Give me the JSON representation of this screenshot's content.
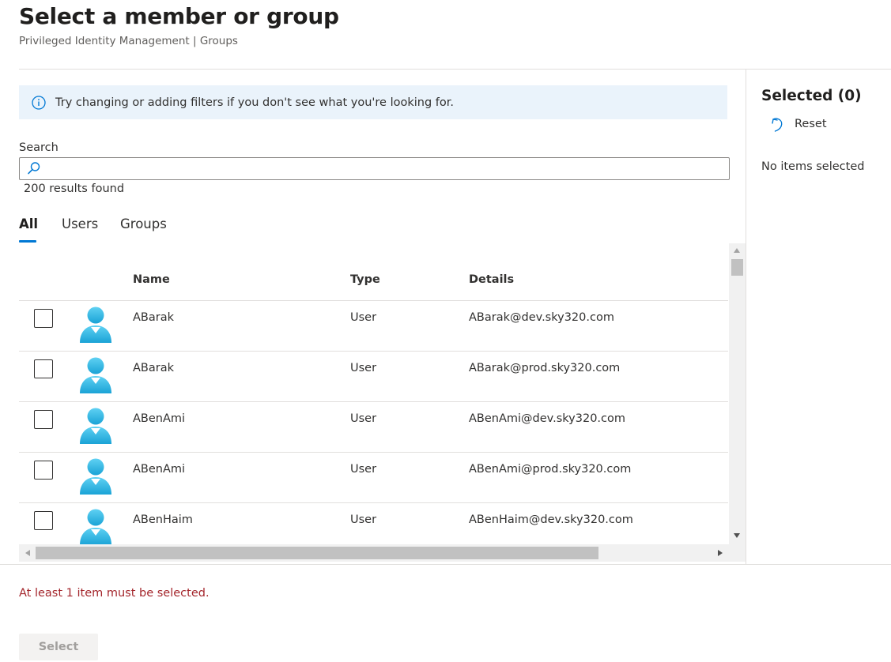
{
  "header": {
    "title": "Select a member or group",
    "subtitle": "Privileged Identity Management | Groups"
  },
  "info_bar": {
    "icon": "info-icon",
    "text": "Try changing or adding filters if you don't see what you're looking for."
  },
  "search": {
    "label": "Search",
    "value": "",
    "placeholder": "",
    "icon": "search-icon",
    "results_text": "200 results found"
  },
  "tabs": [
    {
      "label": "All",
      "active": true
    },
    {
      "label": "Users",
      "active": false
    },
    {
      "label": "Groups",
      "active": false
    }
  ],
  "table": {
    "columns": [
      "Name",
      "Type",
      "Details"
    ],
    "rows": [
      {
        "name": "ABarak",
        "type": "User",
        "details": "ABarak@dev.sky320.com",
        "checked": false
      },
      {
        "name": "ABarak",
        "type": "User",
        "details": "ABarak@prod.sky320.com",
        "checked": false
      },
      {
        "name": "ABenAmi",
        "type": "User",
        "details": "ABenAmi@dev.sky320.com",
        "checked": false
      },
      {
        "name": "ABenAmi",
        "type": "User",
        "details": "ABenAmi@prod.sky320.com",
        "checked": false
      },
      {
        "name": "ABenHaim",
        "type": "User",
        "details": "ABenHaim@dev.sky320.com",
        "checked": false
      }
    ]
  },
  "selected_panel": {
    "title": "Selected (0)",
    "reset_label": "Reset",
    "reset_icon": "undo-icon",
    "empty_text": "No items selected"
  },
  "footer": {
    "error_text": "At least 1 item must be selected.",
    "select_label": "Select",
    "select_disabled": true
  },
  "colors": {
    "accent": "#0078d4",
    "info_bg": "#eaf3fb",
    "error": "#a4262c",
    "avatar": "#2bb5e0"
  }
}
